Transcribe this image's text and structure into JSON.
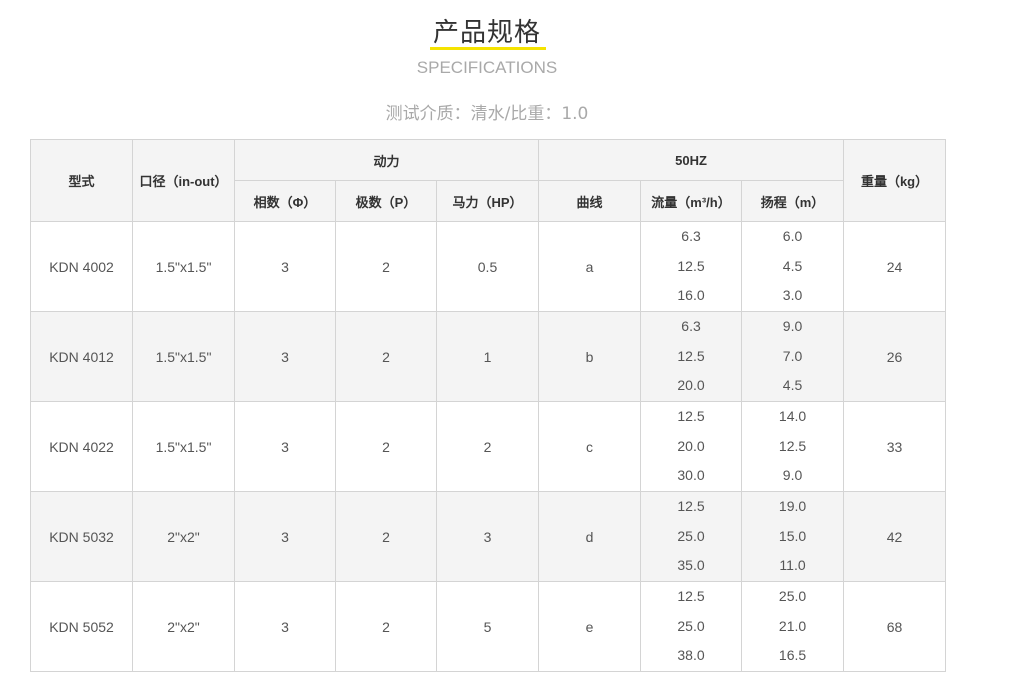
{
  "header": {
    "title": "产品规格",
    "subtitle": "SPECIFICATIONS",
    "note": "测试介质：清水/比重：1.0"
  },
  "table": {
    "headers": {
      "model": "型式",
      "port": "口径（in-out）",
      "power": "动力",
      "freq": "50HZ",
      "weight": "重量（kg）",
      "phase": "相数（Φ）",
      "poles": "极数（P）",
      "hp": "马力（HP）",
      "curve": "曲线",
      "flow": "流量（m³/h）",
      "head": "扬程（m）"
    },
    "rows": [
      {
        "model": "KDN 4002",
        "port": "1.5\"x1.5\"",
        "phase": "3",
        "poles": "2",
        "hp": "0.5",
        "curve": "a",
        "flow": [
          "6.3",
          "12.5",
          "16.0"
        ],
        "head": [
          "6.0",
          "4.5",
          "3.0"
        ],
        "weight": "24"
      },
      {
        "model": "KDN 4012",
        "port": "1.5\"x1.5\"",
        "phase": "3",
        "poles": "2",
        "hp": "1",
        "curve": "b",
        "flow": [
          "6.3",
          "12.5",
          "20.0"
        ],
        "head": [
          "9.0",
          "7.0",
          "4.5"
        ],
        "weight": "26"
      },
      {
        "model": "KDN 4022",
        "port": "1.5\"x1.5\"",
        "phase": "3",
        "poles": "2",
        "hp": "2",
        "curve": "c",
        "flow": [
          "12.5",
          "20.0",
          "30.0"
        ],
        "head": [
          "14.0",
          "12.5",
          "9.0"
        ],
        "weight": "33"
      },
      {
        "model": "KDN 5032",
        "port": "2\"x2\"",
        "phase": "3",
        "poles": "2",
        "hp": "3",
        "curve": "d",
        "flow": [
          "12.5",
          "25.0",
          "35.0"
        ],
        "head": [
          "19.0",
          "15.0",
          "11.0"
        ],
        "weight": "42"
      },
      {
        "model": "KDN 5052",
        "port": "2\"x2\"",
        "phase": "3",
        "poles": "2",
        "hp": "5",
        "curve": "e",
        "flow": [
          "12.5",
          "25.0",
          "38.0"
        ],
        "head": [
          "25.0",
          "21.0",
          "16.5"
        ],
        "weight": "68"
      }
    ]
  }
}
